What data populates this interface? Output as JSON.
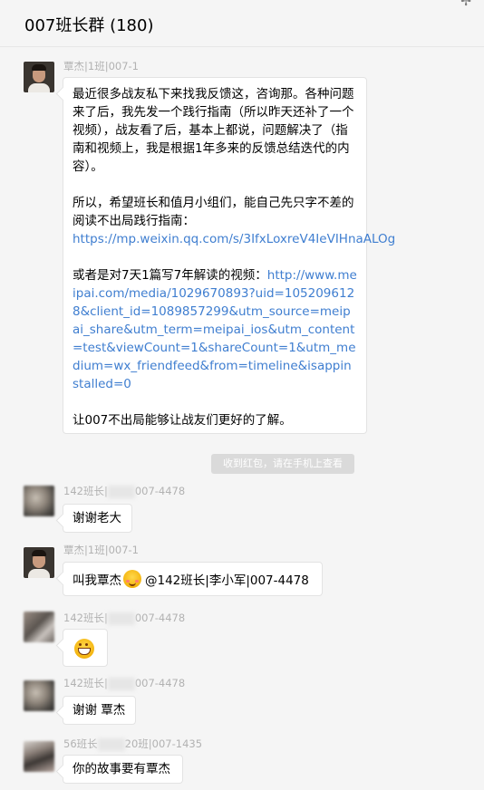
{
  "header": {
    "title": "007班长群 (180)",
    "pin_icon": "pin-icon"
  },
  "messages": [
    {
      "sender": "覃杰|1班|007-1",
      "paragraphs": [
        {
          "text": "最近很多战友私下来找我反馈这，咨询那。各种问题来了后，我先发一个践行指南（所以昨天还补了一个视频），战友看了后，基本上都说，问题解决了（指南和视频上，我是根据1年多来的反馈总结迭代的内容）。"
        },
        {
          "text": "所以，希望班长和值月小组们，能自己先只字不差的阅读不出局践行指南：",
          "link": "https://mp.weixin.qq.com/s/3IfxLoxreV4IeVIHnaALOg"
        },
        {
          "text": "或者是对7天1篇写7年解读的视频：",
          "link": "http://www.meipai.com/media/1029670893?uid=1052096128&client_id=1089857299&utm_source=meipai_share&utm_term=meipai_ios&utm_content=test&viewCount=1&shareCount=1&utm_medium=wx_friendfeed&from=timeline&isappinstalled=0"
        },
        {
          "text": "让007不出局能够让战友们更好的了解。"
        }
      ]
    },
    {
      "system_notice": "收到红包，请在手机上查看"
    },
    {
      "sender_prefix": "142班长|",
      "sender_suffix": "007-4478",
      "text": "谢谢老大"
    },
    {
      "sender": "覃杰|1班|007-1",
      "text_before": "叫我覃杰",
      "emoji": "blush-emoji",
      "text_after": "@142班长|李小军|007-4478"
    },
    {
      "sender_prefix": "142班长|",
      "sender_suffix": "007-4478",
      "emoji": "grin-emoji"
    },
    {
      "sender_prefix": "142班长|",
      "sender_suffix": "007-4478",
      "text": "谢谢 覃杰"
    },
    {
      "sender_prefix": "56班长",
      "sender_suffix": "20班|007-1435",
      "text": "你的故事要有覃杰"
    }
  ]
}
